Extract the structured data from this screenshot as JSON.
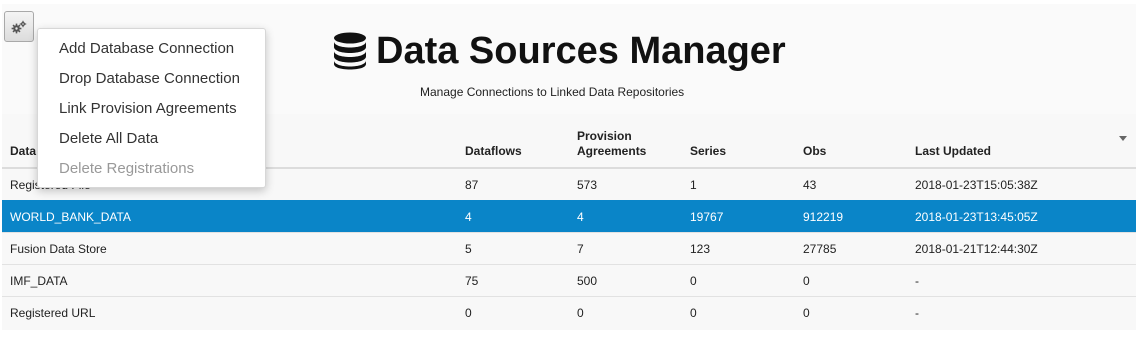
{
  "header": {
    "title": "Data Sources Manager",
    "subtitle": "Manage Connections to Linked Data Repositories"
  },
  "icons": {
    "gear": "gears-icon",
    "title": "database-icon",
    "sort": "caret-down-icon"
  },
  "colors": {
    "selected_row": "#0a85c8",
    "selected_text": "#ffffff",
    "disabled_menu_text": "#999999"
  },
  "menu": {
    "items": [
      {
        "label": "Add Database Connection",
        "enabled": true
      },
      {
        "label": "Drop Database Connection",
        "enabled": true
      },
      {
        "label": "Link Provision Agreements",
        "enabled": true
      },
      {
        "label": "Delete All Data",
        "enabled": true
      },
      {
        "label": "Delete Registrations",
        "enabled": false
      }
    ]
  },
  "table": {
    "columns": [
      "Data",
      "Dataflows",
      "Provision Agreements",
      "Series",
      "Obs",
      "Last Updated"
    ],
    "column_lines": {
      "provision_line1": "Provision",
      "provision_line2": "Agreements"
    },
    "rows": [
      {
        "name": "Registered File",
        "dataflows": "87",
        "provision": "573",
        "series": "1",
        "obs": "43",
        "updated": "2018-01-23T15:05:38Z",
        "selected": false
      },
      {
        "name": "WORLD_BANK_DATA",
        "dataflows": "4",
        "provision": "4",
        "series": "19767",
        "obs": "912219",
        "updated": "2018-01-23T13:45:05Z",
        "selected": true
      },
      {
        "name": "Fusion Data Store",
        "dataflows": "5",
        "provision": "7",
        "series": "123",
        "obs": "27785",
        "updated": "2018-01-21T12:44:30Z",
        "selected": false
      },
      {
        "name": "IMF_DATA",
        "dataflows": "75",
        "provision": "500",
        "series": "0",
        "obs": "0",
        "updated": "-",
        "selected": false
      },
      {
        "name": "Registered URL",
        "dataflows": "0",
        "provision": "0",
        "series": "0",
        "obs": "0",
        "updated": "-",
        "selected": false
      }
    ]
  }
}
